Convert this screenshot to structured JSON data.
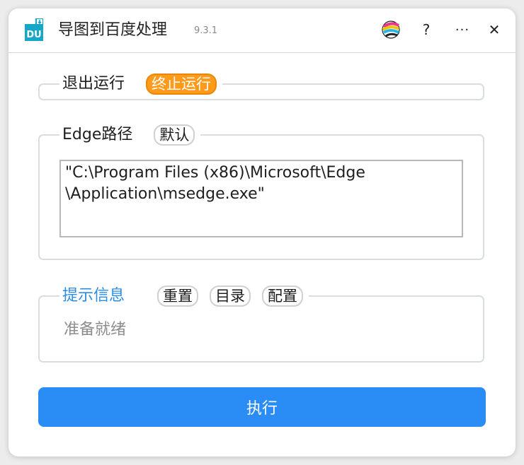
{
  "app": {
    "title": "导图到百度处理",
    "version": "9.3.1",
    "icon_text": "DU"
  },
  "titlebar": {
    "help_label": "?",
    "more_label": "···",
    "close_label": "✕"
  },
  "exit_group": {
    "title": "退出运行",
    "stop_button": "终止运行"
  },
  "edge_group": {
    "title": "Edge路径",
    "default_button": "默认",
    "path_value": "\"C:\\Program Files (x86)\\Microsoft\\Edge\n\\Application\\msedge.exe\""
  },
  "info_group": {
    "title": "提示信息",
    "reset_button": "重置",
    "dir_button": "目录",
    "config_button": "配置",
    "status": "准备就绪"
  },
  "run_button": "执行",
  "colors": {
    "accent": "#2a8cf5",
    "stop": "#ff9a1a",
    "info_title": "#2a8ce6"
  }
}
